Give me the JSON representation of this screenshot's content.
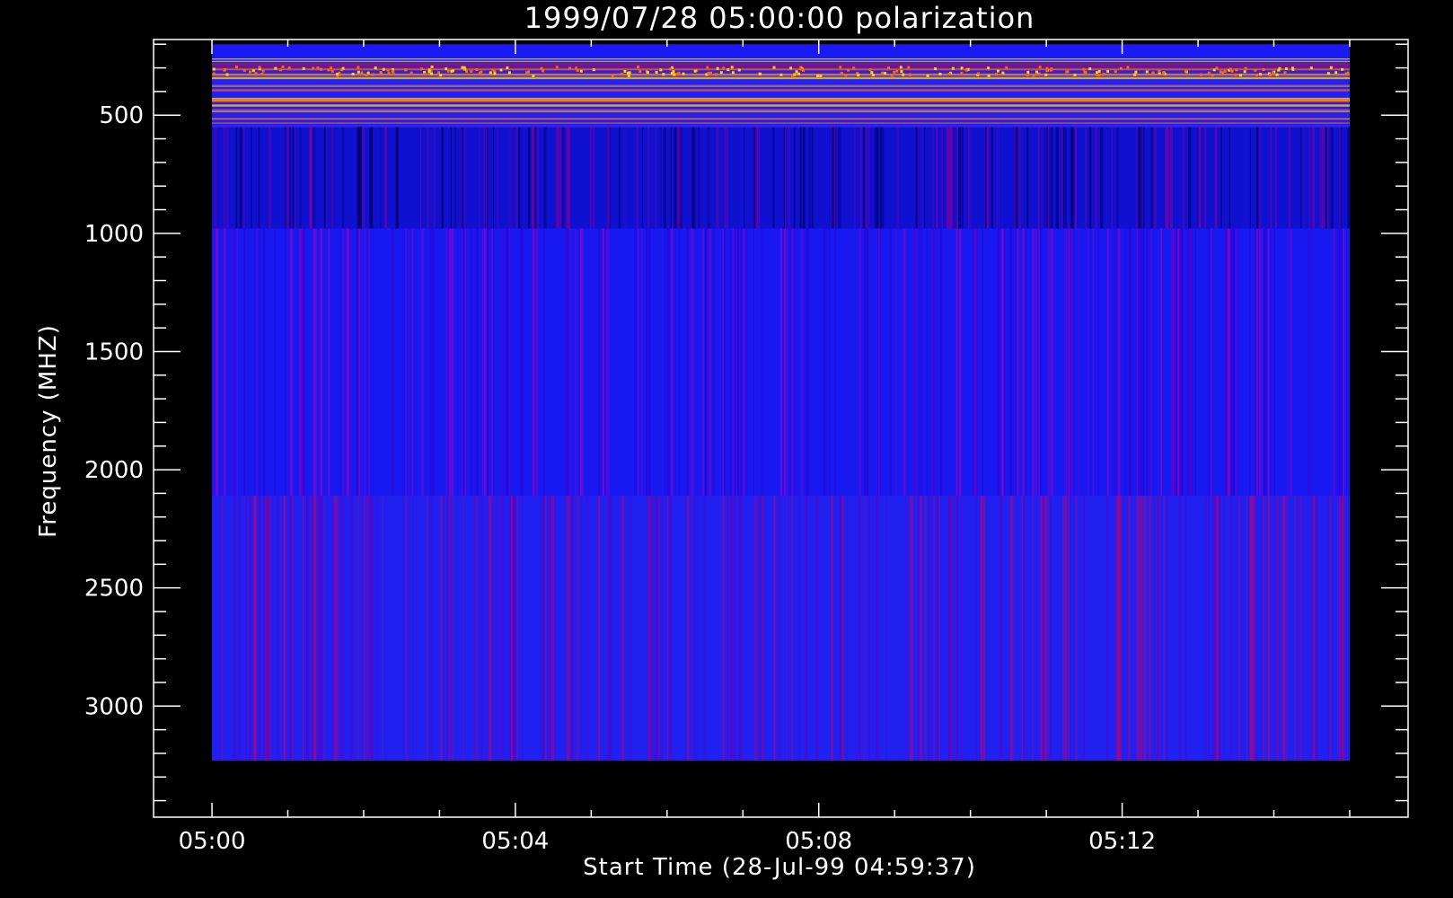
{
  "chart_data": {
    "type": "heatmap",
    "title": "1999/07/28 05:00:00 polarization",
    "xlabel": "Start Time (28-Jul-99 04:59:37)",
    "ylabel": "Frequency (MHZ)",
    "x_tick_labels": [
      "05:00",
      "05:04",
      "05:08",
      "05:12"
    ],
    "x_ticks_minutes": [
      0,
      4,
      8,
      12
    ],
    "xlim_minutes": [
      -0.77,
      15.77
    ],
    "data_x_range_minutes": [
      0,
      15
    ],
    "y_tick_labels": [
      "500",
      "1000",
      "1500",
      "2000",
      "2500",
      "3000"
    ],
    "y_ticks": [
      500,
      1000,
      1500,
      2000,
      2500,
      3000
    ],
    "ylim": [
      180,
      3470
    ],
    "y_inverted": true,
    "y_minor_step": 100,
    "x_minor_step_minutes": 1,
    "bands": [
      {
        "freq_range": [
          260,
          550
        ],
        "level": "strong",
        "description_colors": [
          "#2020ff",
          "#ff6a00",
          "#ffd400",
          "#c01020"
        ]
      },
      {
        "freq_range": [
          550,
          980
        ],
        "level": "low",
        "description_colors": [
          "#1010d0",
          "#000060",
          "#8000a0"
        ]
      },
      {
        "freq_range": [
          980,
          2110
        ],
        "level": "background",
        "description_colors": [
          "#1818f0",
          "#3000d0",
          "#a000c0"
        ]
      },
      {
        "freq_range": [
          2110,
          3230
        ],
        "level": "moderate",
        "description_colors": [
          "#2020f0",
          "#6000c0",
          "#c00070"
        ]
      }
    ],
    "colors": {
      "background": "#000000",
      "axes": "#ffffff",
      "base_blue": "#1a1af5"
    }
  }
}
